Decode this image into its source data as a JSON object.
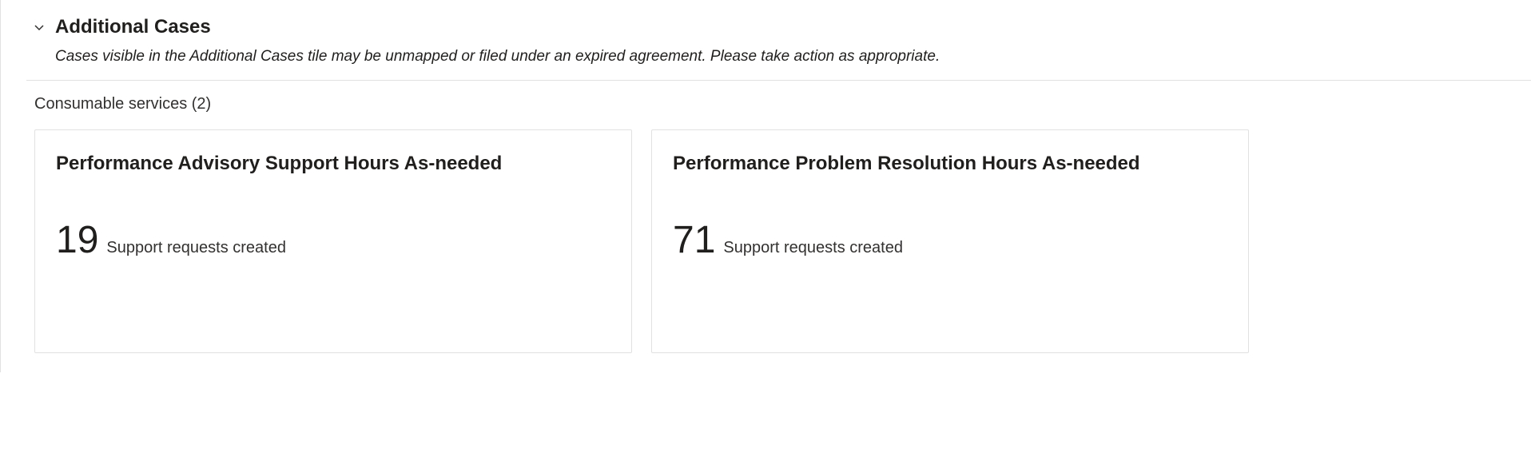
{
  "additional_cases": {
    "title": "Additional Cases",
    "description": "Cases visible in the Additional Cases tile may be unmapped or filed under an expired agreement. Please take action as appropriate."
  },
  "consumable_services": {
    "header": "Consumable services (2)",
    "cards": [
      {
        "title": "Performance Advisory Support Hours As-needed",
        "count": "19",
        "label": "Support requests created"
      },
      {
        "title": "Performance Problem Resolution Hours As-needed",
        "count": "71",
        "label": "Support requests created"
      }
    ]
  }
}
